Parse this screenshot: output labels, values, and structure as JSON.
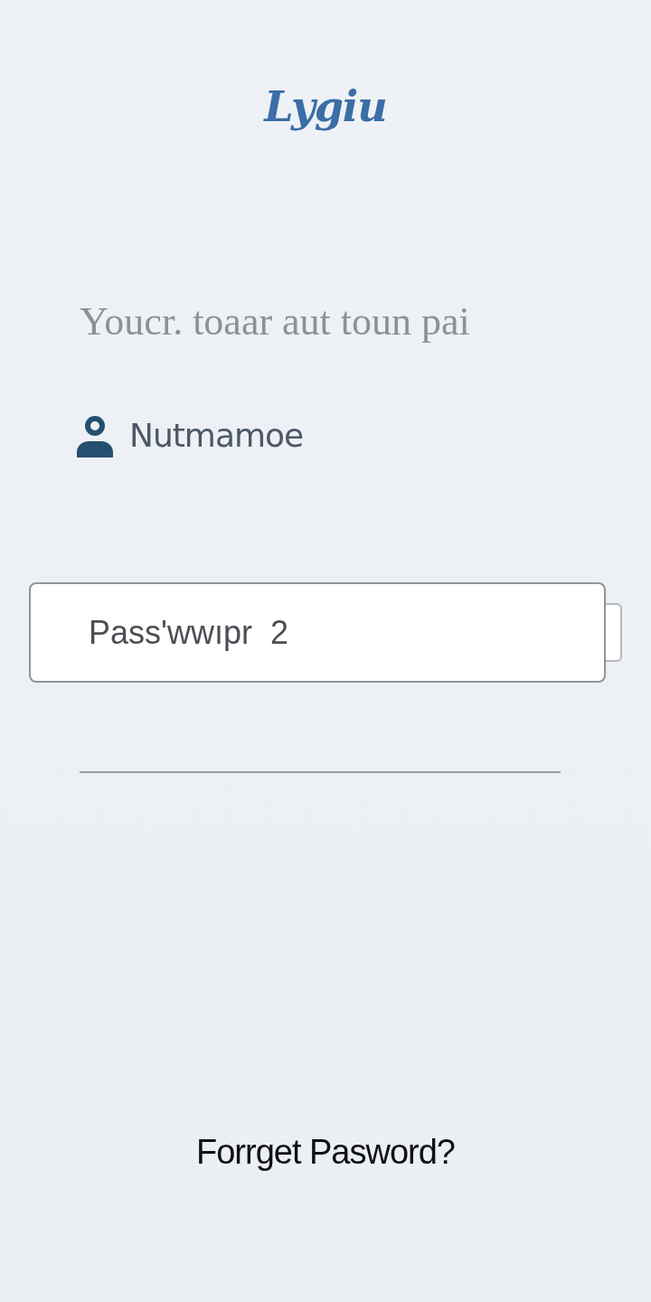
{
  "logo": "Lygiu",
  "subtitle": "Youcr. toaar aut toun pai",
  "username": {
    "label": "Nutmamoe"
  },
  "password": {
    "value": "Pass'wwıpr  2"
  },
  "forgot_link": "Forrget Pasword?"
}
